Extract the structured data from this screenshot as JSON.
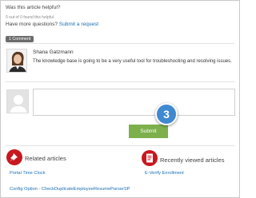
{
  "feedback": {
    "question": "Was this article helpful?",
    "count_text": "0 out of 0 found this helpful",
    "more_prefix": "Have more questions?",
    "submit_request": "Submit a request"
  },
  "comments": {
    "badge": "1 Comment",
    "items": [
      {
        "author": "Shana Gatzmann",
        "text": "The knowledge base is going to be a very useful tool for troubleshooting and resolving issues."
      }
    ]
  },
  "compose": {
    "placeholder": "",
    "submit_label": "Submit",
    "step_number": "3"
  },
  "related": {
    "title": "Related articles",
    "links": [
      "Portal Time Clock",
      "Config Option - CheckDuplicateEmployeeResumeParserSP"
    ]
  },
  "recent": {
    "title": "Recently viewed articles",
    "links": [
      "E-Verify  Enrollment"
    ]
  },
  "colors": {
    "accent_link": "#1a6fb6",
    "submit_green": "#7db04c",
    "icon_red": "#c8181f",
    "step_blue": "#3f89d1"
  },
  "icons": {
    "related": "pin-icon",
    "recent": "document-icon"
  }
}
